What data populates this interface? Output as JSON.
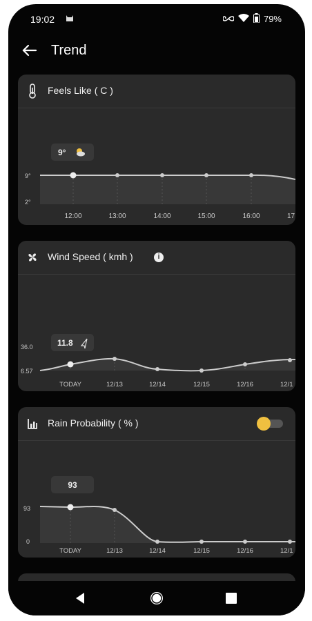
{
  "status_bar": {
    "time": "19:02",
    "battery": "79%",
    "icons": [
      "cat-icon",
      "infinity-icon",
      "wifi-icon",
      "battery-icon"
    ]
  },
  "app_bar": {
    "title": "Trend",
    "back_icon": "arrow-left-icon"
  },
  "cards": [
    {
      "title": "Feels Like ( C )",
      "icon": "thermometer-icon",
      "tooltip": {
        "value": "9°",
        "icon": "partly-cloudy-icon"
      },
      "y_labels": [
        "9°",
        "2°"
      ],
      "x_labels": [
        "12:00",
        "13:00",
        "14:00",
        "15:00",
        "16:00",
        "17"
      ]
    },
    {
      "title": "Wind Speed ( kmh )",
      "icon": "fan-icon",
      "info_icon": "info-icon",
      "tooltip": {
        "value": "11.8",
        "icon": "navigation-arrow-icon"
      },
      "y_labels": [
        "36.0",
        "6.57"
      ],
      "x_labels": [
        "TODAY",
        "12/13",
        "12/14",
        "12/15",
        "12/16",
        "12/1"
      ]
    },
    {
      "title": "Rain Probability ( % )",
      "icon": "rain-gauge-icon",
      "toggle": {
        "on": false,
        "thumb_color": "#f0c040"
      },
      "tooltip": {
        "value": "93"
      },
      "y_labels": [
        "93",
        "0"
      ],
      "x_labels": [
        "TODAY",
        "12/13",
        "12/14",
        "12/15",
        "12/16",
        "12/1"
      ]
    }
  ],
  "nav_bar": {
    "buttons": [
      "back-triangle-icon",
      "home-circle-icon",
      "recents-square-icon"
    ]
  },
  "colors": {
    "background": "#050505",
    "card": "#2a2a2a",
    "line": "#cccccc",
    "accent": "#f0c040"
  }
}
